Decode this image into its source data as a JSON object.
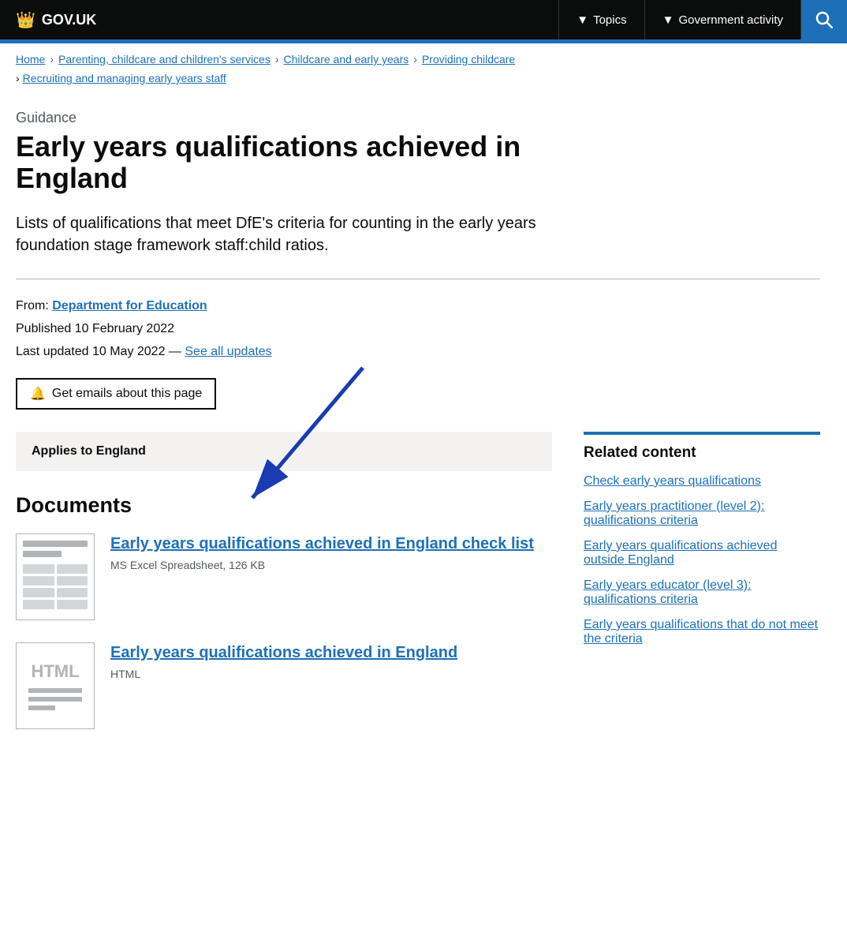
{
  "nav": {
    "logo_text": "GOV.UK",
    "topics_label": "Topics",
    "gov_activity_label": "Government activity"
  },
  "breadcrumb": {
    "items": [
      {
        "label": "Home",
        "href": "#"
      },
      {
        "label": "Parenting, childcare and children's services",
        "href": "#"
      },
      {
        "label": "Childcare and early years",
        "href": "#"
      },
      {
        "label": "Providing childcare",
        "href": "#"
      }
    ],
    "row2": {
      "label": "Recruiting and managing early years staff",
      "href": "#"
    }
  },
  "page": {
    "label": "Guidance",
    "title": "Early years qualifications achieved in England",
    "description": "Lists of qualifications that meet DfE's criteria for counting in the early years foundation stage framework staff:child ratios.",
    "from_label": "From:",
    "from_org": "Department for Education",
    "published": "Published 10 February 2022",
    "updated": "Last updated 10 May 2022 —",
    "see_all": "See all updates",
    "email_btn": "Get emails about this page",
    "applies_to": "Applies to England"
  },
  "documents": {
    "heading": "Documents",
    "items": [
      {
        "id": "doc1",
        "type": "excel",
        "title": "Early years qualifications achieved in England check list",
        "meta": "MS Excel Spreadsheet, 126 KB"
      },
      {
        "id": "doc2",
        "type": "html",
        "title": "Early years qualifications achieved in England",
        "meta": "HTML"
      }
    ]
  },
  "related": {
    "heading": "Related content",
    "links": [
      {
        "label": "Check early years qualifications",
        "href": "#"
      },
      {
        "label": "Early years practitioner (level 2): qualifications criteria",
        "href": "#"
      },
      {
        "label": "Early years qualifications achieved outside England",
        "href": "#"
      },
      {
        "label": "Early years educator (level 3): qualifications criteria",
        "href": "#"
      },
      {
        "label": "Early years qualifications that do not meet the criteria",
        "href": "#"
      }
    ]
  }
}
